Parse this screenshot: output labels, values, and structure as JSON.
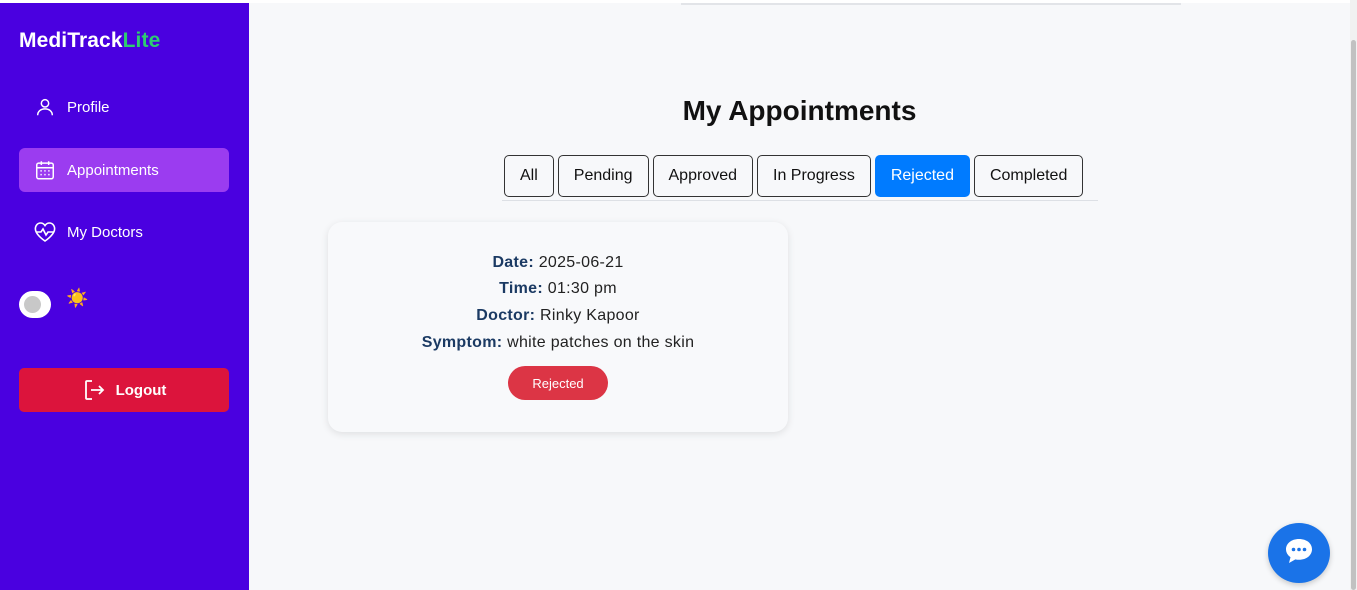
{
  "brand": {
    "main": "MediTrack",
    "accent": "Lite",
    "accent_color": "#2ecc71"
  },
  "sidebar": {
    "items": [
      {
        "label": "Profile",
        "icon": "user-icon"
      },
      {
        "label": "Appointments",
        "icon": "calendar-icon",
        "active": true
      },
      {
        "label": "My Doctors",
        "icon": "heart-pulse-icon"
      }
    ],
    "theme_icon": "☀️",
    "logout_label": "Logout"
  },
  "main": {
    "title": "My Appointments",
    "tabs": [
      {
        "label": "All"
      },
      {
        "label": "Pending"
      },
      {
        "label": "Approved"
      },
      {
        "label": "In Progress"
      },
      {
        "label": "Rejected",
        "active": true
      },
      {
        "label": "Completed"
      }
    ],
    "appointments": [
      {
        "date_label": "Date:",
        "date": "2025-06-21",
        "time_label": "Time:",
        "time": "01:30 pm",
        "doctor_label": "Doctor:",
        "doctor": "Rinky Kapoor",
        "symptom_label": "Symptom:",
        "symptom": "white patches on the skin",
        "status": "Rejected"
      }
    ]
  },
  "colors": {
    "sidebar": "#4a00e0",
    "active_nav": "#9b3cf0",
    "logout": "#dc143c",
    "active_tab": "#007bff",
    "status_rejected": "#dc3545",
    "chat": "#1a73e8"
  },
  "chat_icon": "chat-bubble-icon"
}
